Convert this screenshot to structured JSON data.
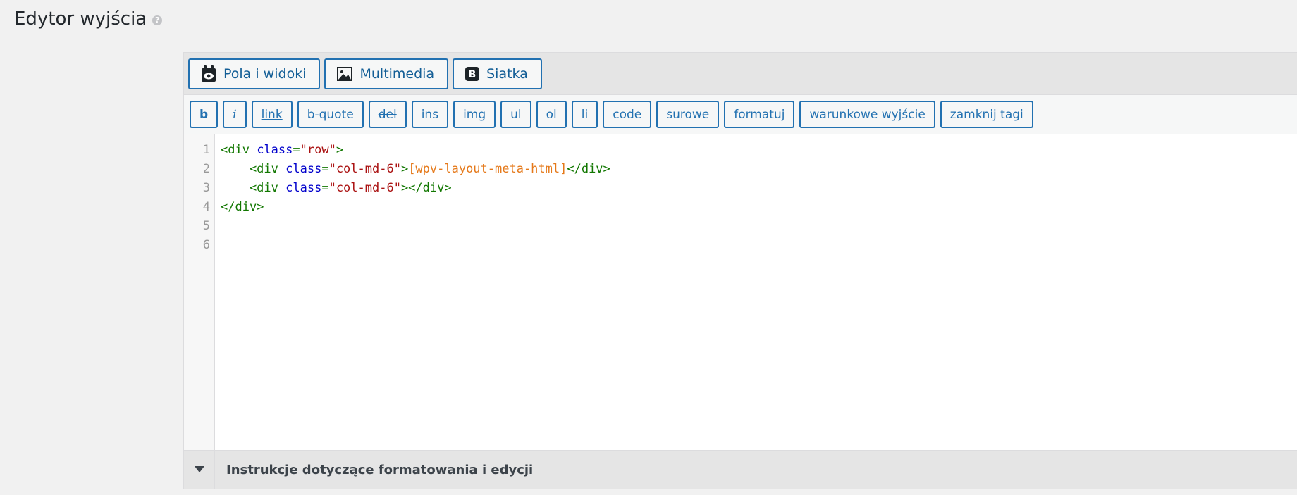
{
  "page": {
    "title": "Edytor wyjścia",
    "help_glyph": "?"
  },
  "top_buttons": [
    {
      "label": "Pola i widoki",
      "icon": "eye-icon"
    },
    {
      "label": "Multimedia",
      "icon": "image-icon"
    },
    {
      "label": "Siatka",
      "icon": "bootstrap-icon",
      "icon_text": "B"
    }
  ],
  "quicktags": [
    {
      "label": "b"
    },
    {
      "label": "i"
    },
    {
      "label": "link"
    },
    {
      "label": "b-quote"
    },
    {
      "label": "del"
    },
    {
      "label": "ins"
    },
    {
      "label": "img"
    },
    {
      "label": "ul"
    },
    {
      "label": "ol"
    },
    {
      "label": "li"
    },
    {
      "label": "code"
    },
    {
      "label": "surowe"
    },
    {
      "label": "formatuj"
    },
    {
      "label": "warunkowe wyjście"
    },
    {
      "label": "zamknij tagi"
    }
  ],
  "code": {
    "line_numbers": [
      "1",
      "2",
      "3",
      "4",
      "5",
      "6"
    ],
    "lines": [
      [
        "<div",
        " ",
        "class",
        "=",
        "\"row\"",
        ">"
      ],
      [
        "    <div",
        " ",
        "class",
        "=",
        "\"col-md-6\"",
        ">",
        "[wpv-layout-meta-html]",
        "</div>"
      ],
      [
        "    <div",
        " ",
        "class",
        "=",
        "\"col-md-6\"",
        "></div>"
      ],
      [
        "</div>"
      ]
    ]
  },
  "footer": {
    "label": "Instrukcje dotyczące formatowania i edycji"
  },
  "colors": {
    "accent": "#2271b1",
    "tag": "#117700",
    "attribute": "#0000cc",
    "string": "#aa1111",
    "shortcode": "#e5791a"
  }
}
